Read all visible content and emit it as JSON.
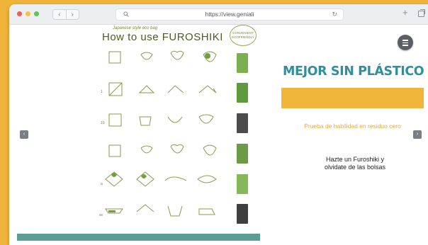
{
  "browser": {
    "url": "https://view.geniali",
    "back_icon": "chevron-left-icon",
    "forward_icon": "chevron-right-icon",
    "new_tab_icon": "plus-icon",
    "tabs_icon": "tabs-icon",
    "search_icon": "search-icon",
    "reload_icon": "reload-icon",
    "back_label": "‹",
    "forward_label": "›",
    "plus_label": "+",
    "reload_label": "↻"
  },
  "slide": {
    "furoshiki_subtitle": "Japanese style eco bag",
    "furoshiki_title": "How to use FUROSHIKI",
    "badge_text": "CONVENIENT ECOFRIENDLY",
    "step_labels": [
      "",
      "1",
      "10",
      "",
      "a",
      "ss"
    ],
    "heading": "MEJOR SIN PLÁSTICO",
    "subline": "Prueba de habilidad en residuo cero",
    "body_text": "Hazte un Furoshiki y olvidate de las bolsas",
    "prev_label": "‹",
    "next_label": "›"
  },
  "colors": {
    "background": "#f1b43a",
    "heading": "#2e8f9e",
    "accent_bar": "#f0b63c",
    "teal_bar": "#5b9e94"
  }
}
